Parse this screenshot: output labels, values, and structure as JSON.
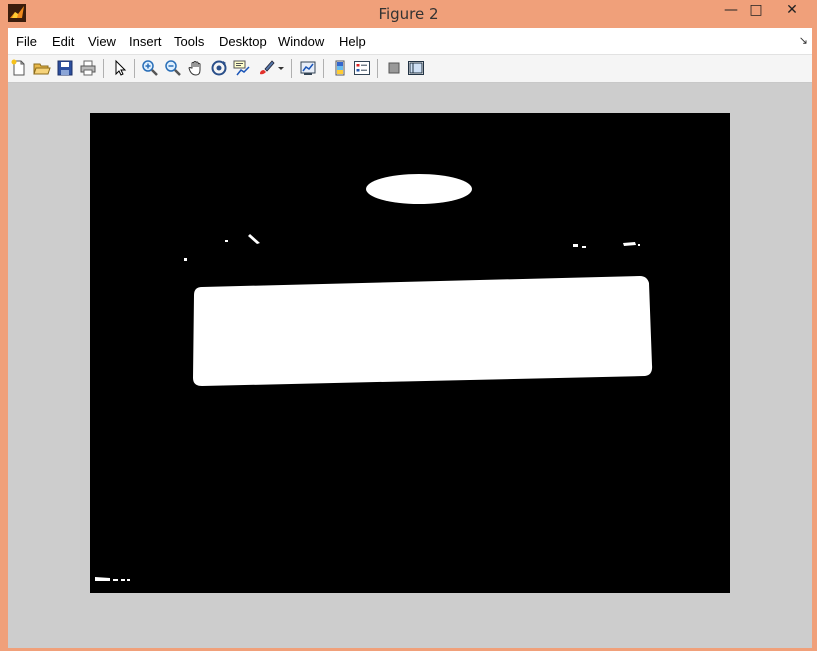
{
  "window": {
    "title": "Figure 2",
    "controls": {
      "minimize": "—",
      "maximize": "□",
      "close": "✕"
    }
  },
  "menubar": {
    "items": [
      "File",
      "Edit",
      "View",
      "Insert",
      "Tools",
      "Desktop",
      "Window",
      "Help"
    ],
    "overflow_icon": "menu-dock-arrow-icon"
  },
  "toolbar": {
    "buttons": [
      "new-figure-icon",
      "open-file-icon",
      "save-icon",
      "print-icon",
      "edit-plot-arrow-icon",
      "zoom-in-icon",
      "zoom-out-icon",
      "pan-hand-icon",
      "rotate-3d-icon",
      "data-cursor-icon",
      "brush-icon",
      "brush-dropdown-icon",
      "link-plot-icon",
      "insert-colorbar-icon",
      "insert-legend-icon",
      "hide-plot-tools-icon",
      "show-plot-tools-icon"
    ]
  },
  "figure": {
    "content": "binary-mask-image",
    "background_color": "#000000",
    "foreground_color": "#ffffff"
  }
}
